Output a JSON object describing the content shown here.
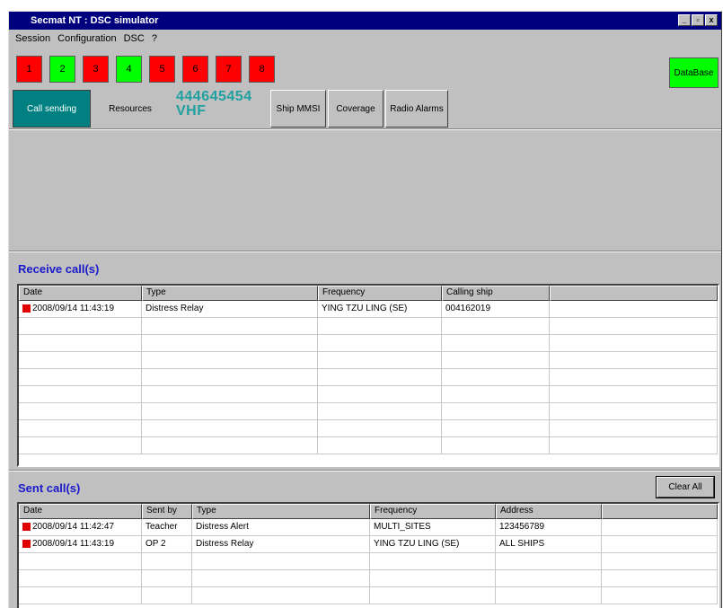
{
  "window": {
    "title": "Secmat NT : DSC simulator",
    "controls": [
      "_",
      "▫",
      "x"
    ]
  },
  "menu": [
    {
      "label": "Session"
    },
    {
      "label": "Configuration"
    },
    {
      "label": "DSC"
    },
    {
      "label": "?"
    }
  ],
  "channels": [
    {
      "label": "1",
      "color": "#ff0000"
    },
    {
      "label": "2",
      "color": "#00ff00"
    },
    {
      "label": "3",
      "color": "#ff0000"
    },
    {
      "label": "4",
      "color": "#00ff00"
    },
    {
      "label": "5",
      "color": "#ff0000"
    },
    {
      "label": "6",
      "color": "#ff0000"
    },
    {
      "label": "7",
      "color": "#ff0000"
    },
    {
      "label": "8",
      "color": "#ff0000"
    }
  ],
  "database_button": "DataBase",
  "tabs": {
    "call_sending": "Call sending",
    "resources": "Resources",
    "mmsi_number": "444645454",
    "band": "VHF",
    "ship_mmsi": "Ship MMSI",
    "coverage": "Coverage",
    "radio_alarms": "Radio Alarms"
  },
  "received": {
    "title": "Receive call(s)",
    "columns": [
      "Date",
      "Type",
      "Frequency",
      "Calling ship",
      ""
    ],
    "rows": [
      {
        "date": "2008/09/14 11:43:19",
        "type": "Distress Relay",
        "frequency": "YING TZU LING (SE)",
        "calling_ship": "004162019",
        "extra": ""
      }
    ]
  },
  "sent": {
    "title": "Sent call(s)",
    "clear_all": "Clear All",
    "columns": [
      "Date",
      "Sent by",
      "Type",
      "Frequency",
      "Address",
      ""
    ],
    "rows": [
      {
        "date": "2008/09/14 11:42:47",
        "sent_by": "Teacher",
        "type": "Distress Alert",
        "frequency": "MULTI_SITES",
        "address": "123456789",
        "extra": ""
      },
      {
        "date": "2008/09/14 11:43:19",
        "sent_by": "OP 2",
        "type": "Distress Relay",
        "frequency": "YING TZU LING (SE)",
        "address": "ALL SHIPS",
        "extra": ""
      }
    ]
  },
  "colors": {
    "titlebar": "#00007e",
    "active_tab": "#008080",
    "section_title": "#1a1acc",
    "flag_red": "#e00000"
  }
}
